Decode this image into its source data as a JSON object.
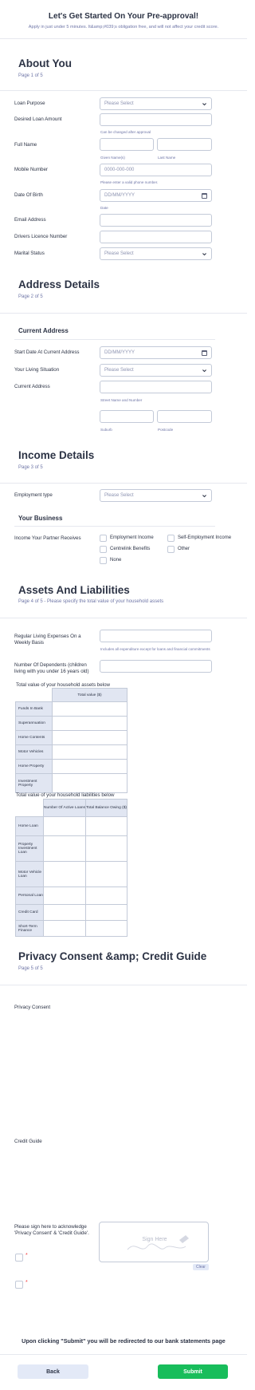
{
  "header": {
    "title": "Let's Get Started On Your Pre-approval!",
    "subtitle": "Apply in just under 5 minutes. It&amp;#039;s obligation free, and will not affect your credit score."
  },
  "about": {
    "title": "About You",
    "page": "Page 1 of 5",
    "loan_purpose": {
      "label": "Loan Purpose",
      "placeholder": "Please Select"
    },
    "loan_amount": {
      "label": "Desired Loan Amount",
      "hint": "Can be changed after approval"
    },
    "full_name": {
      "label": "Full Name",
      "given_hint": "Given Name(s)",
      "last_hint": "Last Name"
    },
    "mobile": {
      "label": "Mobile Number",
      "placeholder": "0000-000-000",
      "hint": "Please enter a valid phone number."
    },
    "dob": {
      "label": "Date Of Birth",
      "placeholder": "DD/MM/YYYY",
      "hint": "Date"
    },
    "email": {
      "label": "Email Address"
    },
    "licence": {
      "label": "Drivers Licence Number"
    },
    "marital": {
      "label": "Marital Status",
      "placeholder": "Please Select"
    }
  },
  "address": {
    "title": "Address Details",
    "page": "Page 2 of 5",
    "current_title": "Current Address",
    "start_date": {
      "label": "Start Date At Current Address",
      "placeholder": "DD/MM/YYYY"
    },
    "living": {
      "label": "Your Living Situation",
      "placeholder": "Please Select"
    },
    "current": {
      "label": "Current Address",
      "street_hint": "Street Name and Number",
      "suburb_hint": "Suburb",
      "postcode_hint": "Postcode"
    }
  },
  "income": {
    "title": "Income Details",
    "page": "Page 3 of 5",
    "employment": {
      "label": "Employment type",
      "placeholder": "Please Select"
    },
    "business_title": "Your Business",
    "partner": {
      "label": "Income Your Partner Receives",
      "options": [
        "Employment Income",
        "Self-Employment Income",
        "Centrelink Benefits",
        "Other",
        "None"
      ]
    }
  },
  "assets": {
    "title": "Assets And Liabilities",
    "page": "Page 4 of 5 - Please specify the total value of your household assets",
    "expenses": {
      "label": "Regular Living Expenses On a Weekly Basis",
      "hint": "Includes all expenditure except for loans and financial commitments"
    },
    "dependents": {
      "label": "Number Of Dependents (children living with you under 16 years old)"
    },
    "assets_table": {
      "caption": "Total value of your household assets below",
      "column": "Total value ($)",
      "rows": [
        "Funds In Bank",
        "Superannuation",
        "Home Contents",
        "Motor Vehicles",
        "Home Property",
        "Investment Property"
      ]
    },
    "liabilities_table": {
      "caption": "Total value of your household liabilities below",
      "columns": [
        "Number Of Active Loans",
        "Total Balance Owing ($)"
      ],
      "rows": [
        "Home Loan",
        "Property Investment Loan",
        "Motor Vehicle Loan",
        "Personal Loan",
        "Credit Card",
        "Short-Term Finance"
      ]
    }
  },
  "privacy": {
    "title": "Privacy Consent &amp; Credit Guide",
    "page": "Page 5 of 5",
    "privacy_label": "Privacy Consent",
    "credit_label": "Credit Guide",
    "sign_label": "Please sign here to acknowledge 'Privacy Consent' & 'Credit Guide'.",
    "sign_placeholder": "Sign Here",
    "clear": "Clear",
    "required_mark": "*"
  },
  "footer": {
    "notice": "Upon clicking \"Submit\" you will be redirected to our bank statements page",
    "back": "Back",
    "submit": "Submit"
  },
  "colors": {
    "accent": "#18bd5b",
    "text": "#2c3345",
    "muted": "#6f76a7",
    "border": "#c3cad8",
    "table_header": "#e1e6f2"
  }
}
